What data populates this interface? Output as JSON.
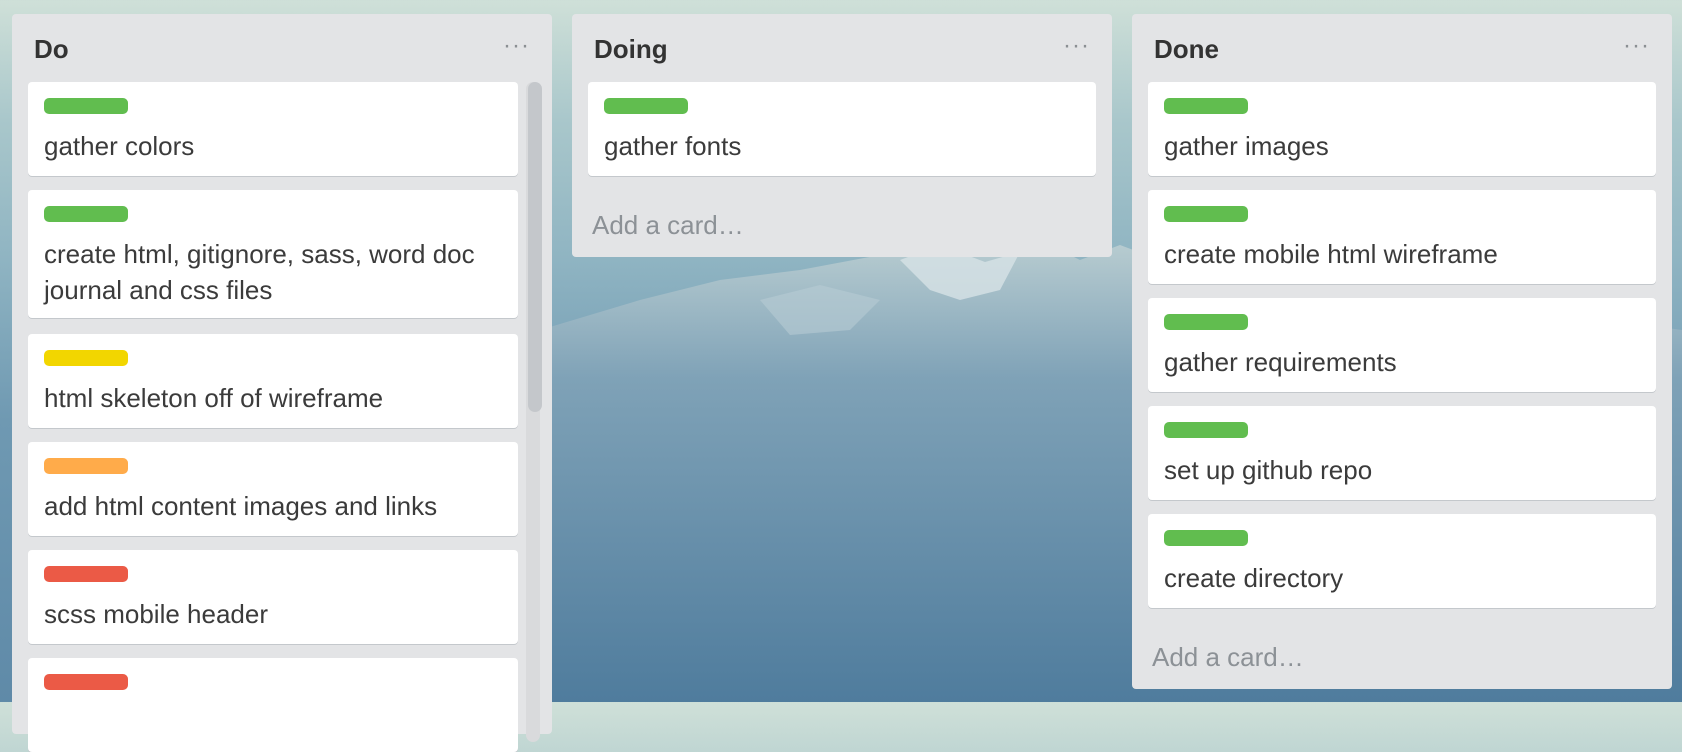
{
  "colors": {
    "green": "#61bd4f",
    "yellow": "#f2d600",
    "orange": "#ffab4a",
    "red": "#eb5a46"
  },
  "lists": {
    "do": {
      "title": "Do",
      "menu_icon": "ellipsis-icon",
      "cards": [
        {
          "label": "green",
          "title": "gather colors"
        },
        {
          "label": "green",
          "title": "create html, gitignore, sass, word doc journal and css files"
        },
        {
          "label": "yellow",
          "title": "html skeleton off of wireframe"
        },
        {
          "label": "orange",
          "title": "add html content images and links"
        },
        {
          "label": "red",
          "title": "scss mobile header"
        },
        {
          "label": "red",
          "title": ""
        }
      ]
    },
    "doing": {
      "title": "Doing",
      "menu_icon": "ellipsis-icon",
      "cards": [
        {
          "label": "green",
          "title": "gather fonts"
        }
      ],
      "add_card": "Add a card…"
    },
    "done": {
      "title": "Done",
      "menu_icon": "ellipsis-icon",
      "cards": [
        {
          "label": "green",
          "title": "gather images"
        },
        {
          "label": "green",
          "title": "create mobile html wireframe"
        },
        {
          "label": "green",
          "title": "gather requirements"
        },
        {
          "label": "green",
          "title": "set up github repo"
        },
        {
          "label": "green",
          "title": "create directory"
        }
      ],
      "add_card": "Add a card…"
    }
  }
}
